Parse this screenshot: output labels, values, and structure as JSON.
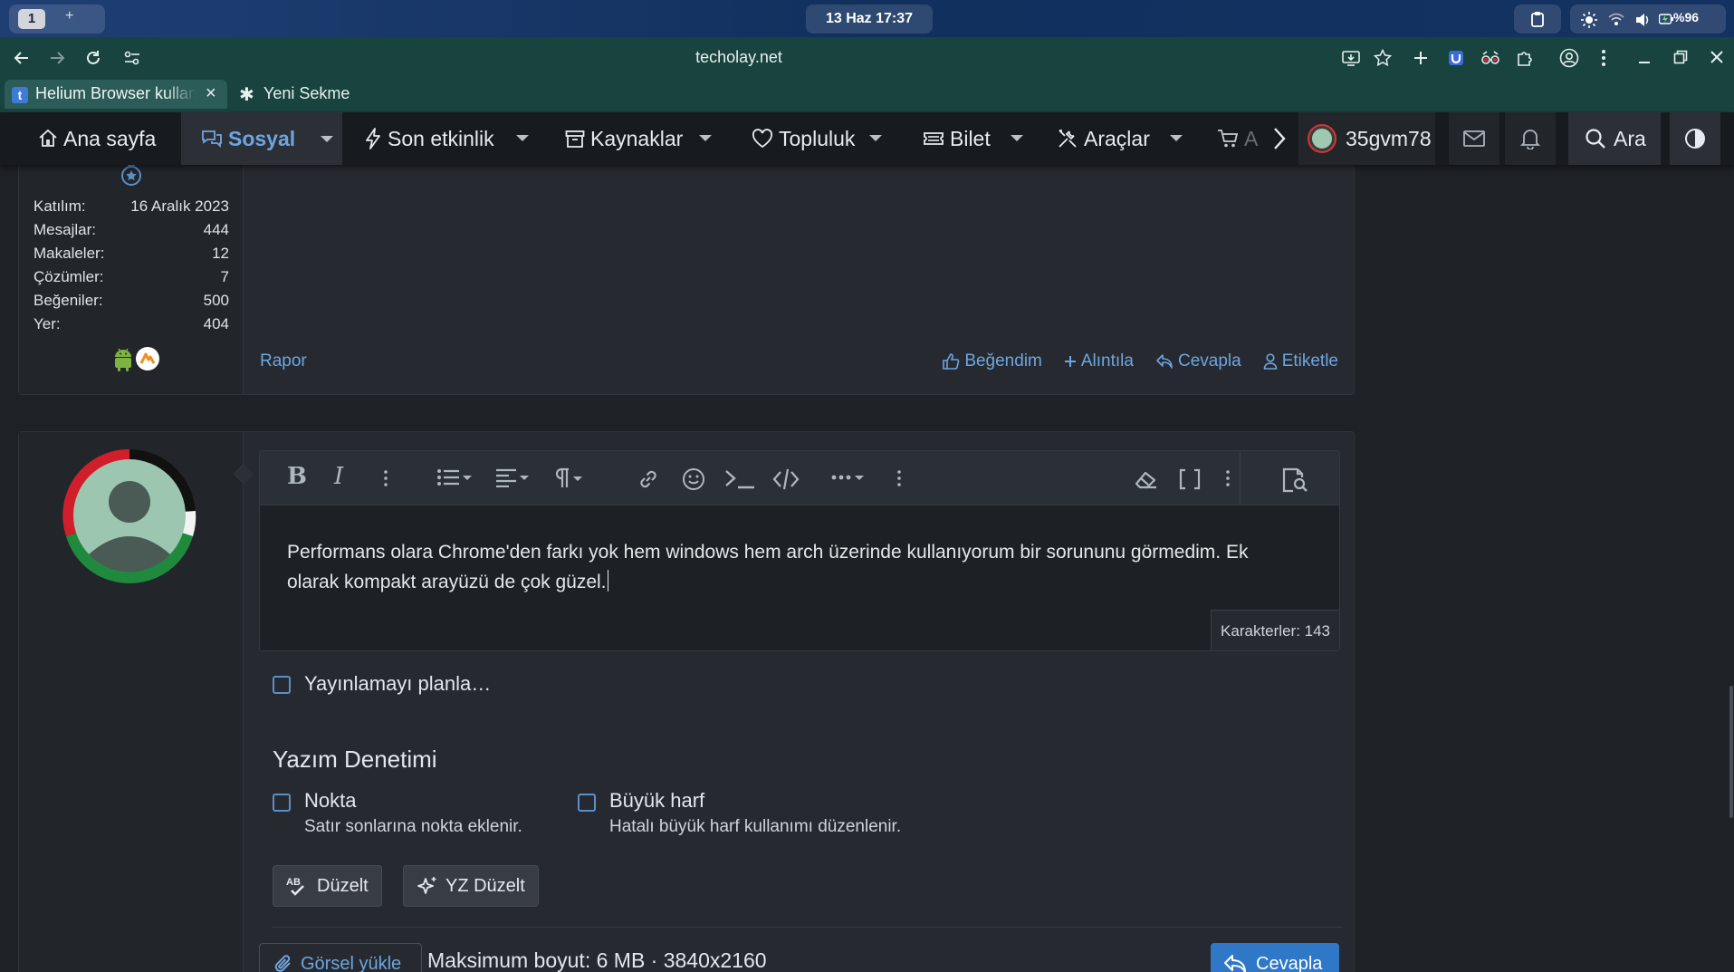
{
  "system": {
    "workspace": "1",
    "workspace_add": "+",
    "clock": "13 Haz  17:37",
    "battery": "%96"
  },
  "browser": {
    "url": "techolay.net",
    "tabs": [
      {
        "favicon": "t",
        "title": "Helium Browser kullanıcı",
        "close": "×"
      },
      {
        "icon": "✱",
        "title": "Yeni Sekme"
      }
    ]
  },
  "nav": {
    "home": "Ana sayfa",
    "social": "Sosyal",
    "recent": "Son etkinlik",
    "resources": "Kaynaklar",
    "community": "Topluluk",
    "ticket": "Bilet",
    "tools": "Araçlar",
    "shop": "A",
    "username": "35gvm78",
    "search": "Ara"
  },
  "post1": {
    "stats": [
      {
        "label": "Katılım:",
        "value": "16 Aralık 2023"
      },
      {
        "label": "Mesajlar:",
        "value": "444"
      },
      {
        "label": "Makaleler:",
        "value": "12"
      },
      {
        "label": "Çözümler:",
        "value": "7"
      },
      {
        "label": "Beğeniler:",
        "value": "500"
      },
      {
        "label": "Yer:",
        "value": "404"
      }
    ],
    "report": "Rapor",
    "like": "Beğendim",
    "quote": "Alıntıla",
    "reply": "Cevapla",
    "tag": "Etiketle"
  },
  "editor": {
    "text": "Performans olara Chrome'den farkı yok hem windows hem arch üzerinde kullanıyorum bir sorununu görmedim. Ek olarak kompakt arayüzü de çok güzel.",
    "char_count": "Karakterler: 143"
  },
  "form": {
    "schedule": "Yayınlamayı planla…",
    "spellcheck_title": "Yazım Denetimi",
    "option1_label": "Nokta",
    "option1_desc": "Satır sonlarına nokta eklenir.",
    "option2_label": "Büyük harf",
    "option2_desc": "Hatalı büyük harf kullanımı düzenlenir.",
    "fix_button": "Düzelt",
    "fix_button_badge": "AB",
    "ai_fix_button": "YZ Düzelt",
    "upload": "Görsel yükle",
    "upload_info": "Maksimum boyut: 6 MB · 3840x2160",
    "submit": "Cevapla"
  },
  "colors": {
    "accent": "#6ea5e0",
    "primary_button": "#2f78c7",
    "browser_chrome": "#18433f"
  }
}
